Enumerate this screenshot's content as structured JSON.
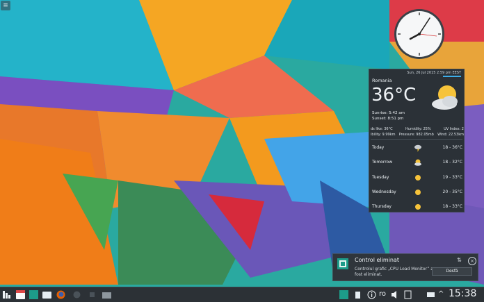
{
  "weather": {
    "date": "Sun, 26 Jul 2015 2:59 pm EEST",
    "location": "Romania",
    "temperature": "36°C",
    "sunrise": "Sunrise: 5:42 am",
    "sunset": "Sunset: 8:51 pm",
    "details_row1": [
      "ds like: 36°C",
      "Humidity: 25%",
      "UV Index: 2"
    ],
    "details_row2": [
      "ibility: 9.99km",
      "Pressure: 982.05mb",
      "Wind: 22.53km"
    ],
    "forecast": [
      {
        "day": "Today",
        "range": "18 - 36°C",
        "icon": "storm-cloud-icon"
      },
      {
        "day": "Tomorrow",
        "range": "18 - 32°C",
        "icon": "sun-cloud-icon"
      },
      {
        "day": "Tuesday",
        "range": "19 - 33°C",
        "icon": "sun-icon"
      },
      {
        "day": "Wednesday",
        "range": "20 - 35°C",
        "icon": "sun-icon"
      },
      {
        "day": "Thursday",
        "range": "18 - 33°C",
        "icon": "sun-icon"
      }
    ]
  },
  "notification": {
    "title": "Control eliminat",
    "body": "Controlul grafic „CPU Load Monitor” a fost eliminat.",
    "action": "Desfă"
  },
  "taskbar": {
    "keyboard_layout": "ro",
    "time": "15:38",
    "icons": [
      "kickoff-icon",
      "calendar-app-icon",
      "terminal-icon",
      "folder-icon",
      "firefox-icon",
      "app-icon",
      "app-icon-2",
      "files-icon"
    ]
  },
  "colors": {
    "accent": "#3daee9",
    "panel": "#2c3136"
  }
}
